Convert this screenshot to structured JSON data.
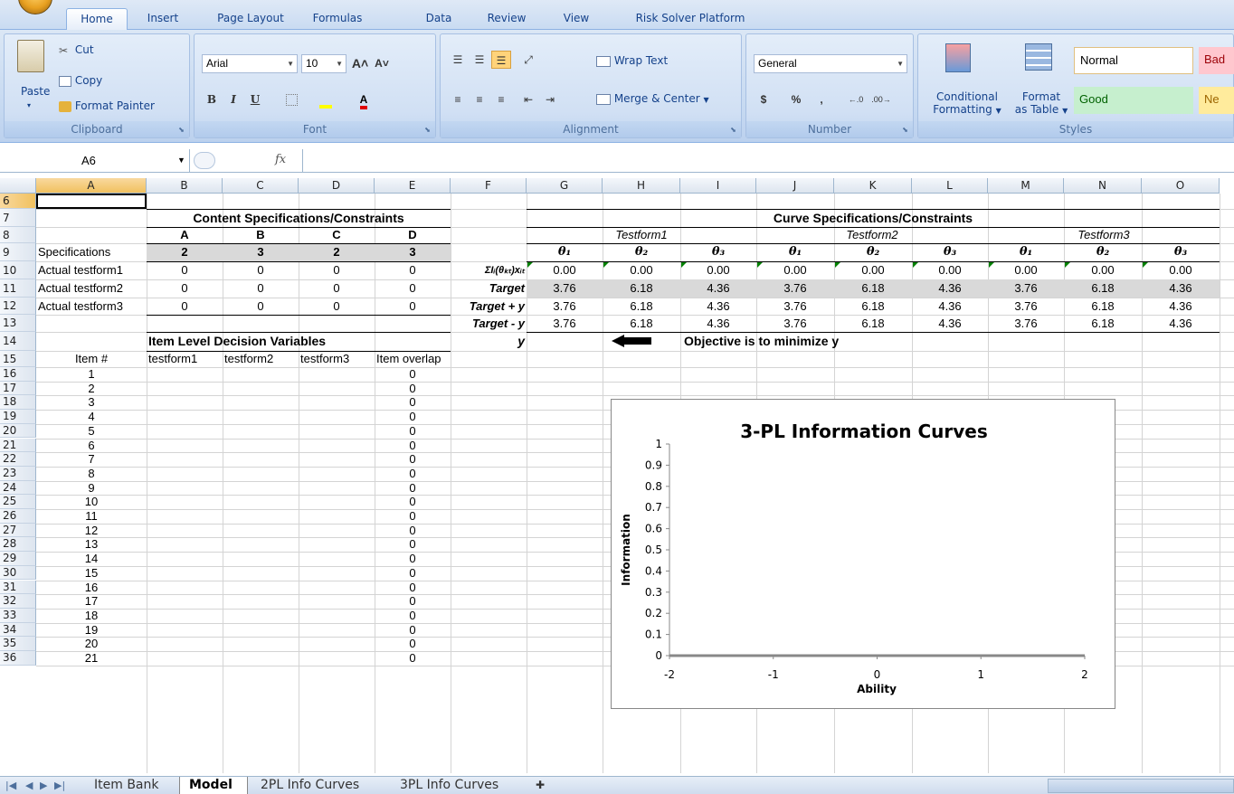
{
  "ribbon_tabs": [
    "Home",
    "Insert",
    "Page Layout",
    "Formulas",
    "Data",
    "Review",
    "View",
    "Risk Solver Platform"
  ],
  "clipboard": {
    "paste": "Paste",
    "cut": "Cut",
    "copy": "Copy",
    "format_painter": "Format Painter",
    "label": "Clipboard"
  },
  "font": {
    "name": "Arial",
    "size": "10",
    "bold": "B",
    "italic": "I",
    "underline": "U",
    "label": "Font"
  },
  "alignment": {
    "wrap_text": "Wrap Text",
    "merge_center": "Merge & Center",
    "label": "Alignment"
  },
  "number": {
    "format": "General",
    "currency": "$",
    "percent": "%",
    "comma": ",",
    "label": "Number"
  },
  "styles": {
    "conditional": "Conditional",
    "formatting": "Formatting",
    "format": "Format",
    "as_table": "as Table",
    "normal": "Normal",
    "good": "Good",
    "bad": "Bad",
    "neutral": "Ne",
    "label": "Styles"
  },
  "formula_bar": {
    "name_box": "A6",
    "fx": "fx",
    "formula": ""
  },
  "columns": [
    "A",
    "B",
    "C",
    "D",
    "E",
    "F",
    "G",
    "H",
    "I",
    "J",
    "K",
    "L",
    "M",
    "N",
    "O"
  ],
  "rows": [
    "6",
    "7",
    "8",
    "9",
    "10",
    "11",
    "12",
    "13",
    "14",
    "15",
    "16",
    "17",
    "18",
    "19",
    "20",
    "21",
    "22",
    "23",
    "24",
    "25",
    "26",
    "27",
    "28",
    "29",
    "30",
    "31",
    "32",
    "33",
    "34",
    "35",
    "36"
  ],
  "content_spec": {
    "title": "Content Specifications/Constraints",
    "headers": [
      "A",
      "B",
      "C",
      "D"
    ],
    "spec_label": "Specifications",
    "specs": [
      "2",
      "3",
      "2",
      "3"
    ],
    "actual": [
      {
        "label": "Actual testform1",
        "values": [
          "0",
          "0",
          "0",
          "0"
        ]
      },
      {
        "label": "Actual testform2",
        "values": [
          "0",
          "0",
          "0",
          "0"
        ]
      },
      {
        "label": "Actual testform3",
        "values": [
          "0",
          "0",
          "0",
          "0"
        ]
      }
    ]
  },
  "curve_spec": {
    "title": "Curve Specifications/Constraints",
    "forms": [
      "Testform1",
      "Testform2",
      "Testform3"
    ],
    "thetas": [
      "θ₁",
      "θ₂",
      "θ₃",
      "θ₁",
      "θ₂",
      "θ₃",
      "θ₁",
      "θ₂",
      "θ₃"
    ],
    "rows": [
      {
        "label": "ΣIᵢ(θₖₜ)xᵢₜ",
        "values": [
          "0.00",
          "0.00",
          "0.00",
          "0.00",
          "0.00",
          "0.00",
          "0.00",
          "0.00",
          "0.00"
        ]
      },
      {
        "label": "Target",
        "values": [
          "3.76",
          "6.18",
          "4.36",
          "3.76",
          "6.18",
          "4.36",
          "3.76",
          "6.18",
          "4.36"
        ]
      },
      {
        "label": "Target + y",
        "values": [
          "3.76",
          "6.18",
          "4.36",
          "3.76",
          "6.18",
          "4.36",
          "3.76",
          "6.18",
          "4.36"
        ]
      },
      {
        "label": "Target - y",
        "values": [
          "3.76",
          "6.18",
          "4.36",
          "3.76",
          "6.18",
          "4.36",
          "3.76",
          "6.18",
          "4.36"
        ]
      }
    ],
    "y_label": "y",
    "objective": "Objective is to minimize y"
  },
  "decision": {
    "title": "Item Level Decision Variables",
    "headers": [
      "Item #",
      "testform1",
      "testform2",
      "testform3",
      "Item overlap"
    ],
    "items": [
      "1",
      "2",
      "3",
      "4",
      "5",
      "6",
      "7",
      "8",
      "9",
      "10",
      "11",
      "12",
      "13",
      "14",
      "15",
      "16",
      "17",
      "18",
      "19",
      "20",
      "21"
    ],
    "overlap": [
      "0",
      "0",
      "0",
      "0",
      "0",
      "0",
      "0",
      "0",
      "0",
      "0",
      "0",
      "0",
      "0",
      "0",
      "0",
      "0",
      "0",
      "0",
      "0",
      "0",
      "0"
    ]
  },
  "chart_data": {
    "type": "line",
    "title": "3-PL Information Curves",
    "xlabel": "Ability",
    "ylabel": "Information",
    "xlim": [
      -2,
      2
    ],
    "ylim": [
      0,
      1
    ],
    "xticks": [
      "-2",
      "-1",
      "0",
      "1",
      "2"
    ],
    "yticks": [
      "0",
      "0.1",
      "0.2",
      "0.3",
      "0.4",
      "0.5",
      "0.6",
      "0.7",
      "0.8",
      "0.9",
      "1"
    ],
    "series": []
  },
  "sheet_tabs": [
    "Item Bank",
    "Model",
    "2PL Info Curves",
    "3PL Info Curves"
  ]
}
